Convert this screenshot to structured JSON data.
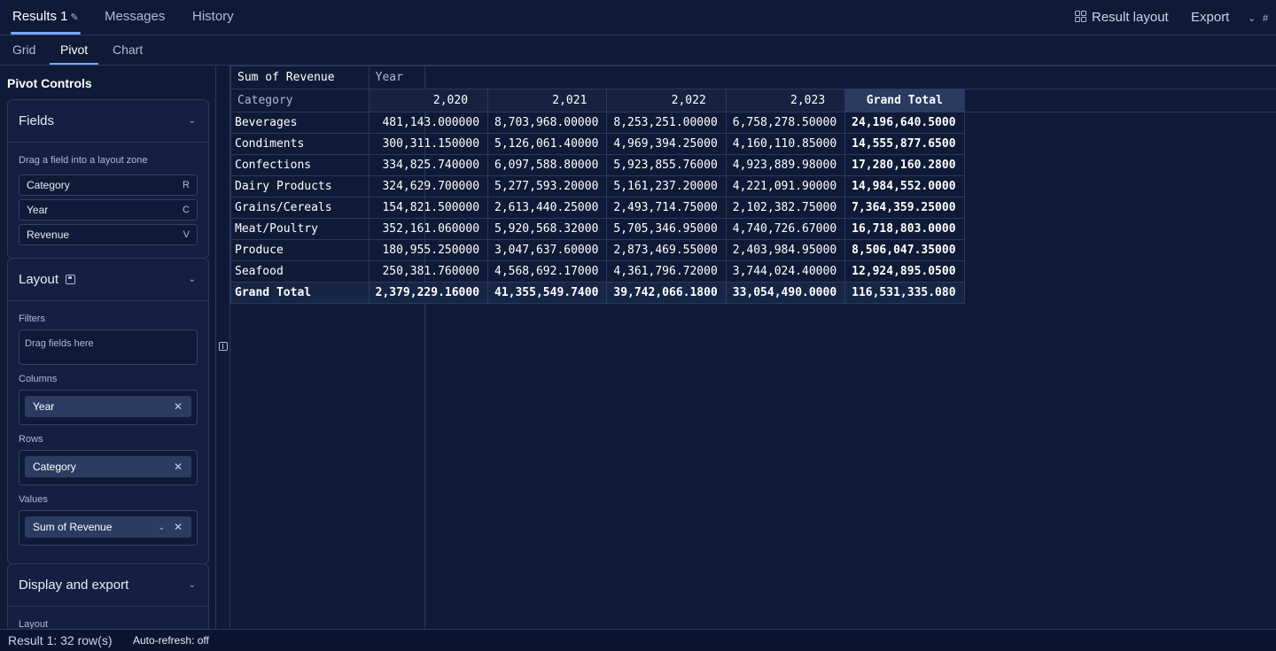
{
  "tabs": {
    "results": "Results 1",
    "messages": "Messages",
    "history": "History",
    "result_layout": "Result layout",
    "export": "Export"
  },
  "subtabs": [
    "Grid",
    "Pivot",
    "Chart"
  ],
  "panel": {
    "title": "Pivot Controls",
    "fields_title": "Fields",
    "fields_hint": "Drag a field into a layout zone",
    "fields": [
      {
        "label": "Category",
        "key": "R"
      },
      {
        "label": "Year",
        "key": "C"
      },
      {
        "label": "Revenue",
        "key": "V"
      }
    ],
    "layout_title": "Layout",
    "filters_label": "Filters",
    "filters_placeholder": "Drag fields here",
    "columns_label": "Columns",
    "columns_chip": "Year",
    "rows_label": "Rows",
    "rows_chip": "Category",
    "values_label": "Values",
    "values_chip": "Sum of Revenue",
    "display_title": "Display and export",
    "layout_sub": "Layout"
  },
  "pivot": {
    "value_label": "Sum of Revenue",
    "column_field": "Year",
    "row_field": "Category",
    "years": [
      "2,020",
      "2,021",
      "2,022",
      "2,023"
    ],
    "grand_total_label": "Grand Total",
    "rows": [
      {
        "label": "Beverages",
        "values": [
          "481,143.000000",
          "8,703,968.00000",
          "8,253,251.00000",
          "6,758,278.50000"
        ],
        "total": "24,196,640.5000"
      },
      {
        "label": "Condiments",
        "values": [
          "300,311.150000",
          "5,126,061.40000",
          "4,969,394.25000",
          "4,160,110.85000"
        ],
        "total": "14,555,877.6500"
      },
      {
        "label": "Confections",
        "values": [
          "334,825.740000",
          "6,097,588.80000",
          "5,923,855.76000",
          "4,923,889.98000"
        ],
        "total": "17,280,160.2800"
      },
      {
        "label": "Dairy Products",
        "values": [
          "324,629.700000",
          "5,277,593.20000",
          "5,161,237.20000",
          "4,221,091.90000"
        ],
        "total": "14,984,552.0000"
      },
      {
        "label": "Grains/Cereals",
        "values": [
          "154,821.500000",
          "2,613,440.25000",
          "2,493,714.75000",
          "2,102,382.75000"
        ],
        "total": "7,364,359.25000"
      },
      {
        "label": "Meat/Poultry",
        "values": [
          "352,161.060000",
          "5,920,568.32000",
          "5,705,346.95000",
          "4,740,726.67000"
        ],
        "total": "16,718,803.0000"
      },
      {
        "label": "Produce",
        "values": [
          "180,955.250000",
          "3,047,637.60000",
          "2,873,469.55000",
          "2,403,984.95000"
        ],
        "total": "8,506,047.35000"
      },
      {
        "label": "Seafood",
        "values": [
          "250,381.760000",
          "4,568,692.17000",
          "4,361,796.72000",
          "3,744,024.40000"
        ],
        "total": "12,924,895.0500"
      }
    ],
    "grand_row": {
      "label": "Grand Total",
      "values": [
        "2,379,229.16000",
        "41,355,549.7400",
        "39,742,066.1800",
        "33,054,490.0000"
      ],
      "total": "116,531,335.080"
    }
  },
  "status": {
    "result": "Result 1: 32 row(s)",
    "autorefresh": "Auto-refresh: off"
  }
}
